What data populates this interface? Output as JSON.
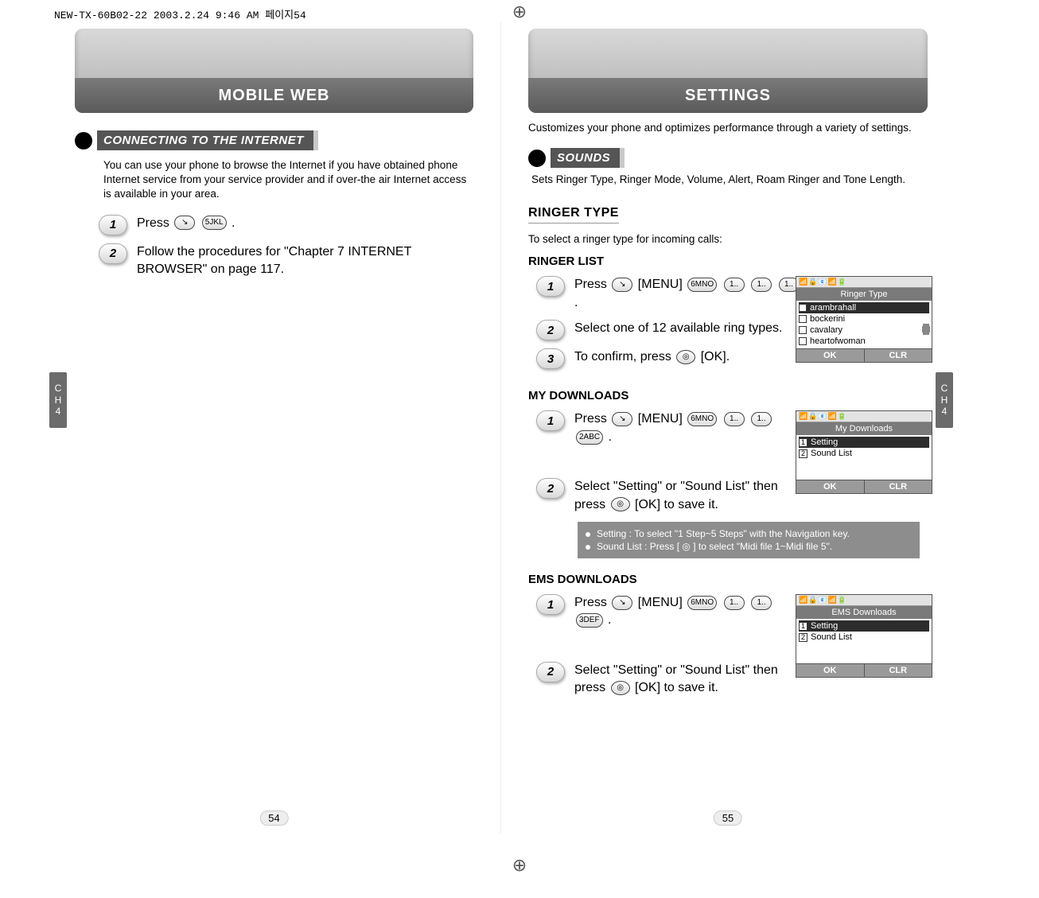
{
  "print_header": "NEW-TX-60B02-22  2003.2.24 9:46 AM  페이지54",
  "side_tab": {
    "line1": "C",
    "line2": "H",
    "line3": "4"
  },
  "left_page": {
    "title": "MOBILE WEB",
    "section_title": "CONNECTING TO THE INTERNET",
    "intro": "You can use your phone to browse the Internet if you have obtained phone Internet service from your service provider and if over-the air Internet access is available in your area.",
    "steps": [
      {
        "num": "1",
        "text_before": "Press ",
        "keys": [
          "↘",
          "5JKL"
        ],
        "text_after": " ."
      },
      {
        "num": "2",
        "text_before": "Follow the procedures for \"Chapter 7 INTERNET BROWSER\" on page 117.",
        "keys": [],
        "text_after": ""
      }
    ],
    "page_num": "54"
  },
  "right_page": {
    "title": "SETTINGS",
    "top_intro": "Customizes your phone and optimizes performance through a variety of settings.",
    "section_title": "SOUNDS",
    "section_intro": "Sets Ringer Type, Ringer Mode, Volume, Alert, Roam Ringer and Tone Length.",
    "ringer_type_heading": "RINGER TYPE",
    "ringer_type_note": "To select a ringer type for incoming calls:",
    "ringer_list_heading": "RINGER LIST",
    "ringer_list_steps": [
      {
        "num": "1",
        "text_before": "Press ",
        "menu": "[MENU]",
        "keys": [
          "↘",
          "6MNO",
          "1..",
          "1..",
          "1.."
        ],
        "text_after": " ."
      },
      {
        "num": "2",
        "text_before": "Select one of 12 available ring types.",
        "keys": [],
        "text_after": ""
      },
      {
        "num": "3",
        "text_before": "To confirm, press ",
        "ok": true,
        "text_after": " [OK]."
      }
    ],
    "screen_ringer": {
      "title": "Ringer Type",
      "items": [
        "arambrahall",
        "bockerini",
        "cavalary",
        "heartofwoman"
      ],
      "selected_index": 0,
      "soft_left": "OK",
      "soft_right": "CLR"
    },
    "my_downloads_heading": "MY DOWNLOADS",
    "my_downloads_steps": [
      {
        "num": "1",
        "text_before": "Press ",
        "menu": "[MENU]",
        "keys": [
          "↘",
          "6MNO",
          "1..",
          "1..",
          "2ABC"
        ],
        "text_after": " ."
      },
      {
        "num": "2",
        "text_before": "Select \"Setting\" or \"Sound List\" then press ",
        "ok": true,
        "text_after": " [OK] to save it."
      }
    ],
    "screen_my_downloads": {
      "title": "My Downloads",
      "items": [
        "Setting",
        "Sound List"
      ],
      "selected_index": 0,
      "soft_left": "OK",
      "soft_right": "CLR"
    },
    "tips": [
      "Setting : To select \"1 Step~5 Steps\" with the Navigation key.",
      "Sound List : Press [ ◎ ] to select \"Midi file 1~Midi file 5\"."
    ],
    "ems_downloads_heading": "EMS DOWNLOADS",
    "ems_downloads_steps": [
      {
        "num": "1",
        "text_before": "Press ",
        "menu": "[MENU]",
        "keys": [
          "↘",
          "6MNO",
          "1..",
          "1..",
          "3DEF"
        ],
        "text_after": " ."
      },
      {
        "num": "2",
        "text_before": "Select \"Setting\" or \"Sound List\" then press ",
        "ok": true,
        "text_after": " [OK] to save it."
      }
    ],
    "screen_ems_downloads": {
      "title": "EMS Downloads",
      "items": [
        "Setting",
        "Sound List"
      ],
      "selected_index": 0,
      "soft_left": "OK",
      "soft_right": "CLR"
    },
    "page_num": "55"
  }
}
